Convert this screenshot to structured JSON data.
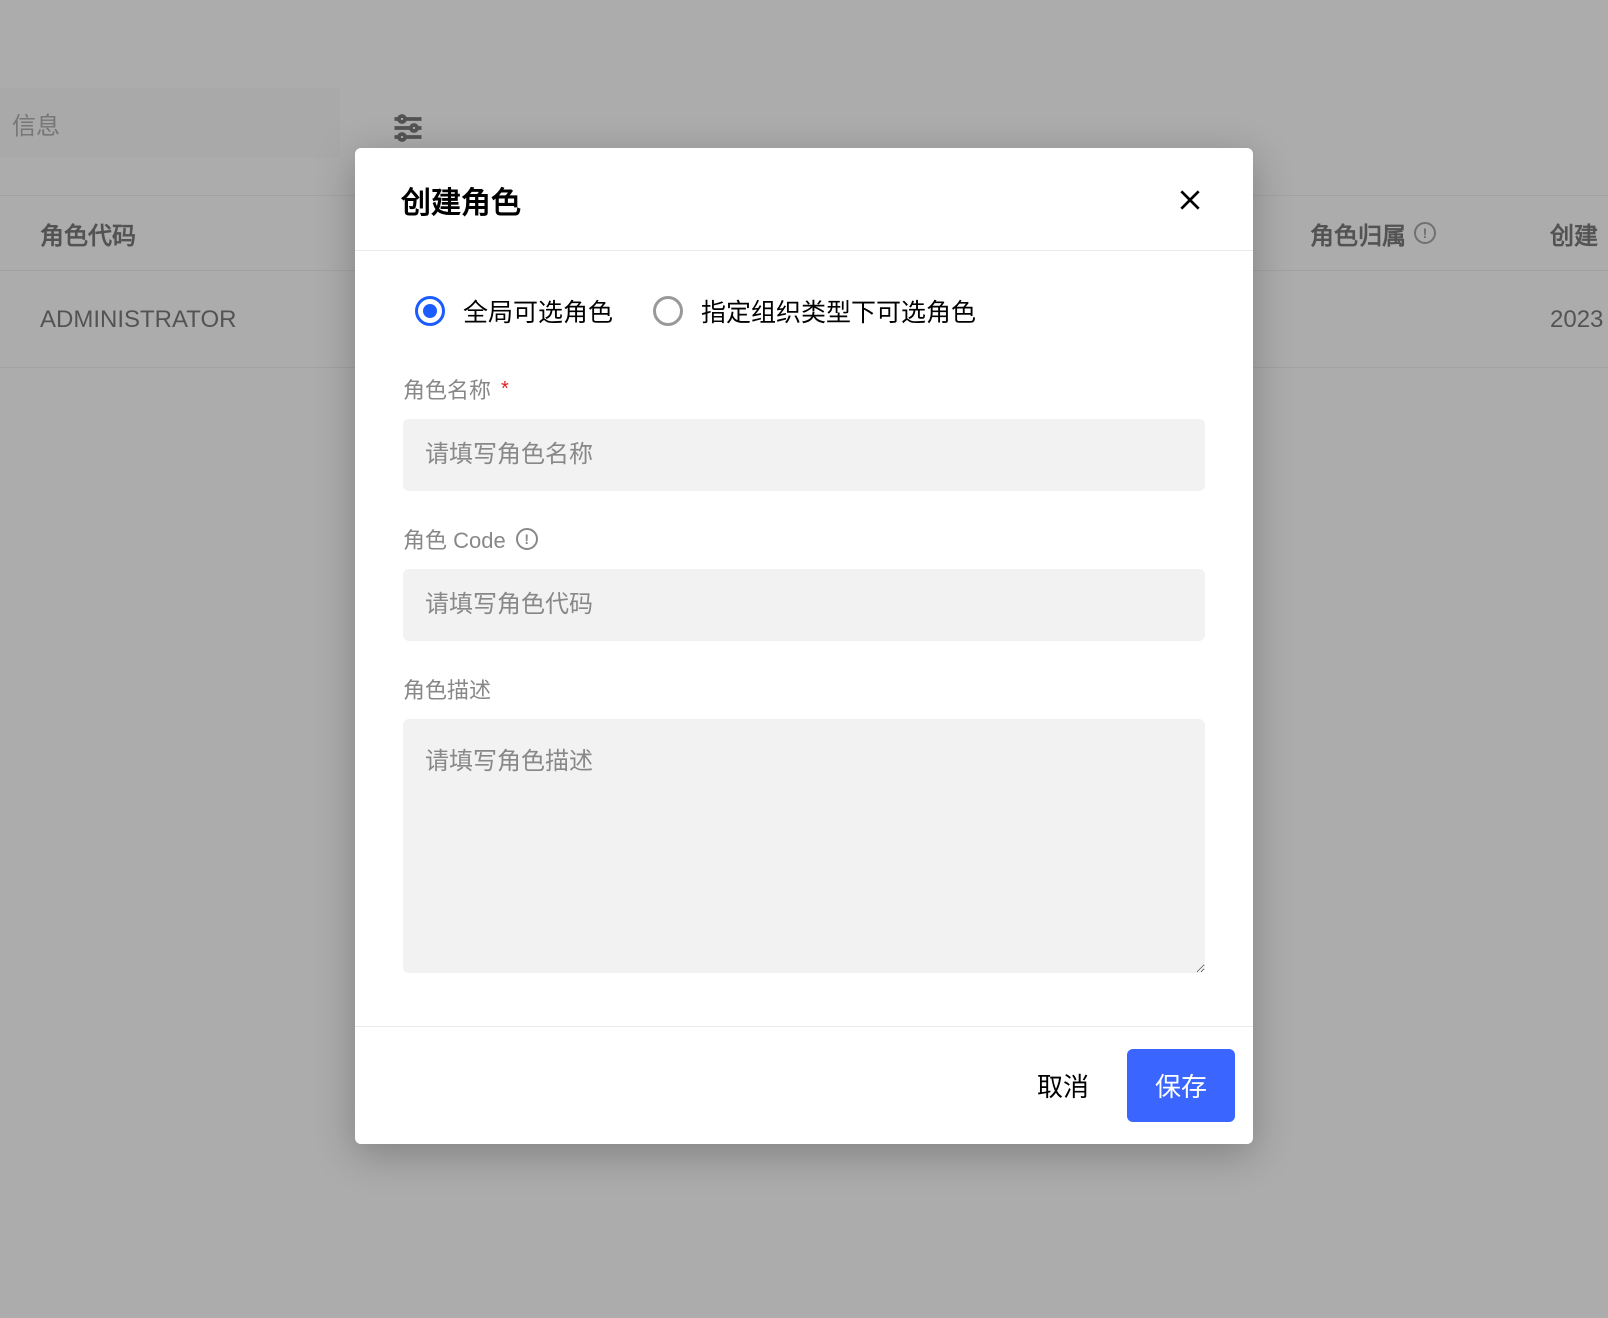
{
  "background": {
    "tab_label": "信息",
    "table": {
      "headers": {
        "code": "角色代码",
        "belonging": "角色归属",
        "created": "创建"
      },
      "row": {
        "code": "ADMINISTRATOR",
        "created": "2023"
      }
    }
  },
  "modal": {
    "title": "创建角色",
    "radio": {
      "option1": "全局可选角色",
      "option2": "指定组织类型下可选角色",
      "selected": "option1"
    },
    "fields": {
      "name": {
        "label": "角色名称",
        "placeholder": "请填写角色名称",
        "value": ""
      },
      "code": {
        "label": "角色 Code",
        "placeholder": "请填写角色代码",
        "value": ""
      },
      "description": {
        "label": "角色描述",
        "placeholder": "请填写角色描述",
        "value": ""
      }
    },
    "footer": {
      "cancel": "取消",
      "save": "保存"
    }
  }
}
